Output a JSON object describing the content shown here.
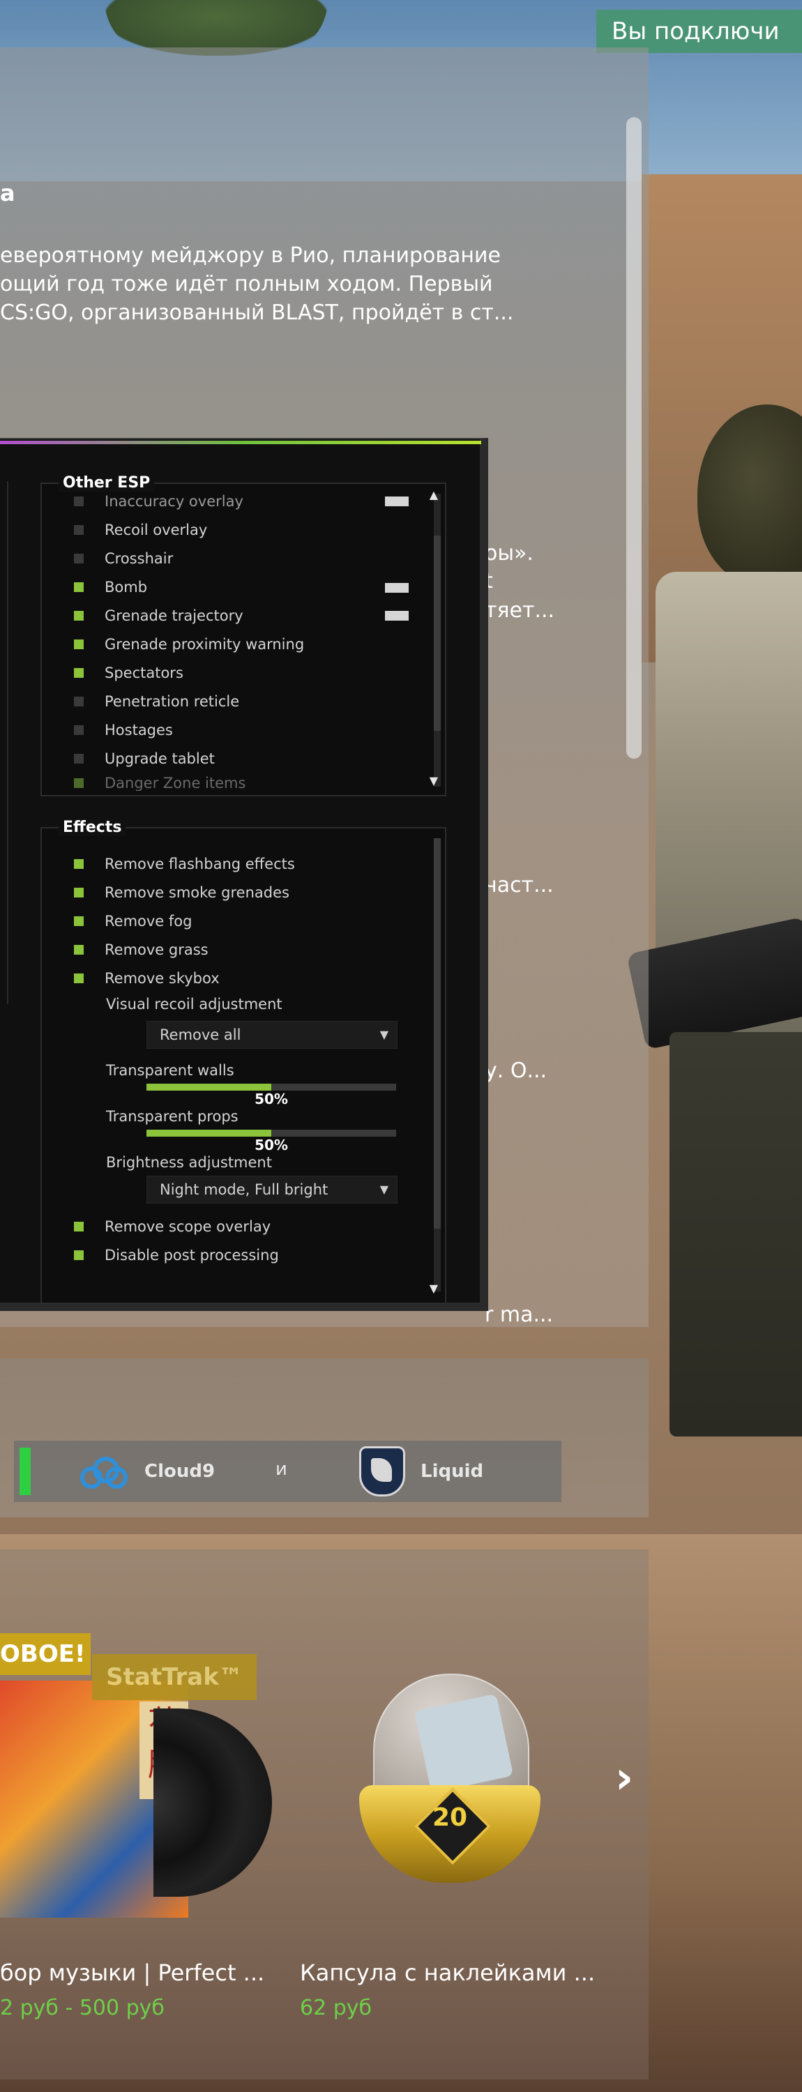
{
  "notification": {
    "text": "Вы подключи"
  },
  "news": {
    "title": "a",
    "body_lines": [
      "евероятному мейджору в Рио, планирование",
      "ощий год тоже идёт полным ходом. Первый",
      "CS:GO, организованный BLAST, пройдёт в ст..."
    ],
    "frag_1": "оы».",
    "frag_2": "t",
    "frag_3": "тяет...",
    "frag_4": "част...",
    "frag_5": "у. О...",
    "frag_6": "r ma..."
  },
  "esp_menu": {
    "other_esp": {
      "title": "Other ESP",
      "items": [
        {
          "label": "Inaccuracy overlay",
          "checked": false,
          "color": "#d6d6d6"
        },
        {
          "label": "Recoil overlay",
          "checked": false
        },
        {
          "label": "Crosshair",
          "checked": false
        },
        {
          "label": "Bomb",
          "checked": true,
          "color": "#d6d6d6"
        },
        {
          "label": "Grenade trajectory",
          "checked": true,
          "color": "#d6d6d6"
        },
        {
          "label": "Grenade proximity warning",
          "checked": true
        },
        {
          "label": "Spectators",
          "checked": true
        },
        {
          "label": "Penetration reticle",
          "checked": false
        },
        {
          "label": "Hostages",
          "checked": false
        },
        {
          "label": "Upgrade tablet",
          "checked": false
        },
        {
          "label": "Danger Zone items",
          "checked": true
        }
      ]
    },
    "effects": {
      "title": "Effects",
      "items": [
        {
          "label": "Remove flashbang effects",
          "checked": true
        },
        {
          "label": "Remove smoke grenades",
          "checked": true
        },
        {
          "label": "Remove fog",
          "checked": true
        },
        {
          "label": "Remove grass",
          "checked": true
        },
        {
          "label": "Remove skybox",
          "checked": true
        }
      ],
      "visual_recoil": {
        "label": "Visual recoil adjustment",
        "value": "Remove all"
      },
      "transparent_walls": {
        "label": "Transparent walls",
        "value": 50,
        "display": "50%"
      },
      "transparent_props": {
        "label": "Transparent props",
        "value": 50,
        "display": "50%"
      },
      "brightness": {
        "label": "Brightness adjustment",
        "value": "Night mode, Full bright"
      },
      "items_after": [
        {
          "label": "Remove scope overlay",
          "checked": true
        },
        {
          "label": "Disable post processing",
          "checked": true
        }
      ]
    }
  },
  "match": {
    "team_a": "Cloud9",
    "separator": "и",
    "team_b": "Liquid",
    "status_color": "#2fcf42"
  },
  "store": {
    "badge_new": "ОВОЕ!",
    "badge_stattrak": "StatTrak™",
    "items": [
      {
        "name": "бор музыки | Perfect ...",
        "price": "2 руб - 500 руб",
        "icon": "music-kit-icon"
      },
      {
        "name": "Капсула с наклейками ...",
        "price": "62 руб",
        "icon": "sticker-capsule-icon"
      }
    ],
    "capsule_label": "20"
  }
}
